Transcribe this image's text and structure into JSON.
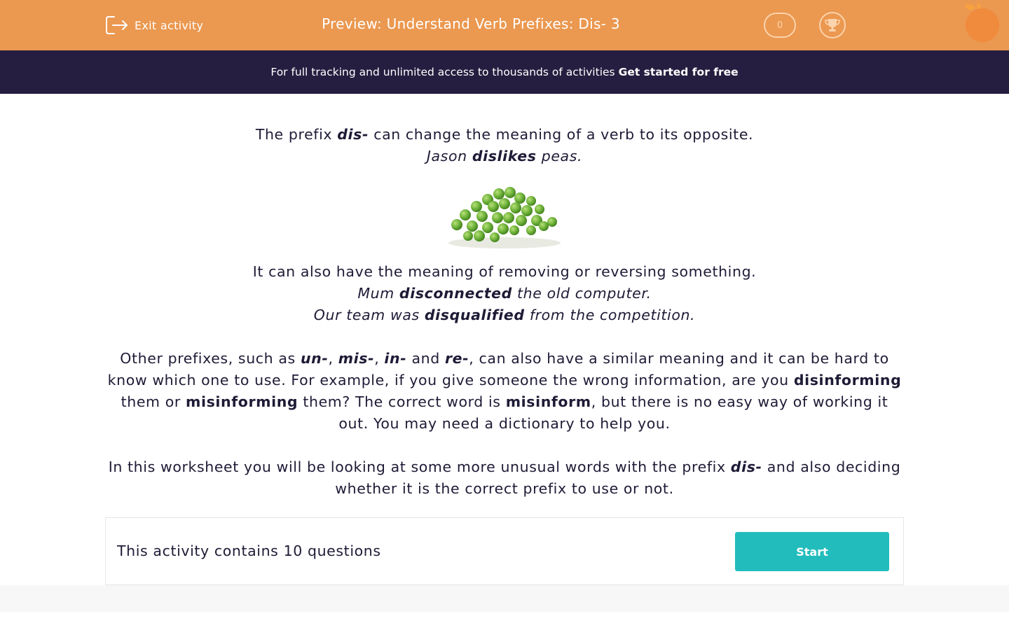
{
  "header": {
    "exit_label": "Exit activity",
    "title": "Preview: Understand Verb Prefixes: Dis- 3",
    "score": "0",
    "bg_color": "#eb9850"
  },
  "promo": {
    "text": "For full tracking and unlimited access to thousands of activities",
    "link": "Get started for free",
    "bg_color": "#251e40"
  },
  "intro": {
    "p1": {
      "a": "The prefix ",
      "b": "dis-",
      "c": " can change the meaning of a verb to its opposite."
    },
    "ex1": {
      "a": "Jason ",
      "b": "dislikes",
      "c": " peas."
    },
    "p2": "It can also have the meaning of removing or reversing something.",
    "ex2": {
      "a": "Mum ",
      "b": "disconnected",
      "c": " the old computer."
    },
    "ex3": {
      "a": "Our team was ",
      "b": "disqualified",
      "c": " from the competition."
    },
    "p3": {
      "a": "Other prefixes, such as ",
      "un": "un-",
      "sep1": ", ",
      "mis": "mis-",
      "sep2": ", ",
      "in": "in-",
      "and": " and ",
      "re": "re-",
      "b": ", can also have a similar meaning and it can be hard to know which one to use. For example, if you give someone the wrong information, are you ",
      "w1": "disinforming",
      "c": " them or ",
      "w2": "misinforming",
      "d": " them? The correct word is ",
      "w3": "misinform",
      "e": ", but there is no easy way of working it out. You may need a dictionary to help you."
    },
    "p4": {
      "a": "In this worksheet you will be looking at some more unusual words with the prefix ",
      "b": "dis-",
      "c": " and also deciding whether it is the correct prefix to use or not."
    }
  },
  "footer": {
    "question_count_text": "This activity contains 10 questions",
    "start_label": "Start",
    "start_color": "#23bcbc"
  }
}
